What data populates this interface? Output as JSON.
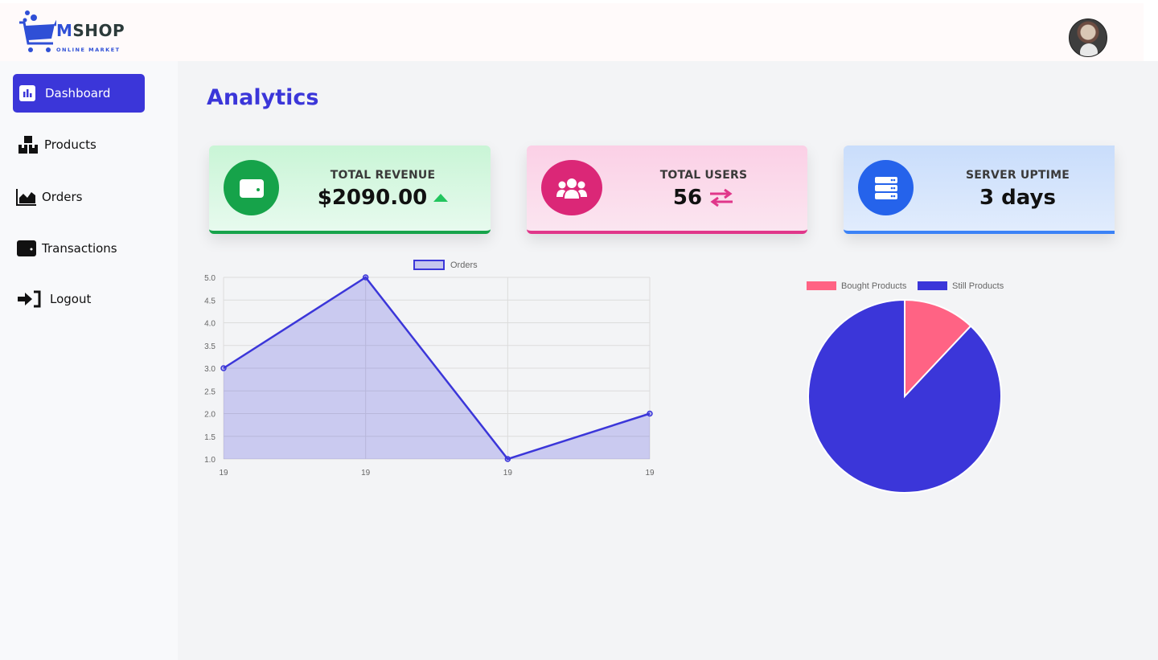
{
  "brand": {
    "name_initial": "M",
    "name_rest": "SHOP",
    "tagline": "ONLINE MARKET"
  },
  "sidebar": {
    "items": [
      {
        "label": "Dashboard",
        "icon": "bar-chart-icon",
        "active": true
      },
      {
        "label": "Products",
        "icon": "boxes-icon",
        "active": false
      },
      {
        "label": "Orders",
        "icon": "area-chart-icon",
        "active": false
      },
      {
        "label": "Transactions",
        "icon": "wallet-icon",
        "active": false
      },
      {
        "label": "Logout",
        "icon": "logout-icon",
        "active": false
      }
    ]
  },
  "main": {
    "title": "Analytics"
  },
  "cards": [
    {
      "title": "TOTAL REVENUE",
      "value": "$2090.00",
      "icon": "wallet-icon",
      "trend_icon": "caret-up-icon",
      "color": "#16a34a"
    },
    {
      "title": "TOTAL USERS",
      "value": "56",
      "icon": "users-icon",
      "trend_icon": "exchange-arrows-icon",
      "color": "#e0378a"
    },
    {
      "title": "SERVER UPTIME",
      "value": "3 days",
      "icon": "server-icon",
      "color": "#2563eb"
    }
  ],
  "colors": {
    "accent": "#3b36d9",
    "pie_bought": "#ff6384"
  },
  "chart_data": [
    {
      "type": "area",
      "series": [
        {
          "name": "Orders",
          "values": [
            3,
            5,
            1,
            2
          ]
        }
      ],
      "categories": [
        "19",
        "19",
        "19",
        "19"
      ],
      "yticks": [
        "5.0",
        "4.5",
        "4.0",
        "3.5",
        "3.0",
        "2.5",
        "2.0",
        "1.5",
        "1.0"
      ],
      "ylim": [
        1,
        5
      ],
      "grid": true,
      "legend": "top-center"
    },
    {
      "type": "pie",
      "labels": [
        "Bought Products",
        "Still Products"
      ],
      "values": [
        12,
        88
      ],
      "colors": [
        "#ff6384",
        "#3b36d9"
      ],
      "legend": "top-center"
    }
  ]
}
